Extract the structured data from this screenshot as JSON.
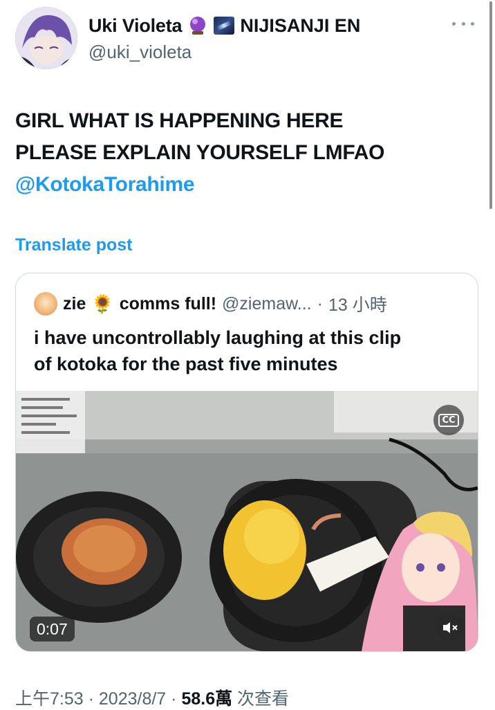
{
  "author": {
    "display_name": "Uki Violeta",
    "affiliation": "NIJISANJI EN",
    "handle": "@uki_violeta",
    "badges": [
      "crystal-ball-icon",
      "galaxy-icon"
    ]
  },
  "tweet": {
    "lines": [
      "GIRL WHAT IS HAPPENING HERE",
      "PLEASE EXPLAIN YOURSELF LMFAO"
    ],
    "mention": "@KotokaTorahime",
    "translate_label": "Translate post"
  },
  "quote": {
    "name": "zie",
    "flower": "🌻",
    "name_suffix": "comms full!",
    "handle": "@ziemaw...",
    "separator": "·",
    "time": "13 小時",
    "lines": [
      "i have uncontrollably laughing at this clip",
      "of kotoka for the past five minutes"
    ],
    "video": {
      "duration": "0:07",
      "cc_label": "CC",
      "muted": true
    }
  },
  "meta": {
    "time": "上午7:53",
    "sep1": " · ",
    "date": "2023/8/7",
    "sep2": " · ",
    "views": "58.6萬",
    "views_label": " 次查看"
  },
  "colors": {
    "link": "#1d9bf0",
    "secondary_text": "#536471",
    "border": "#cfd9de"
  }
}
